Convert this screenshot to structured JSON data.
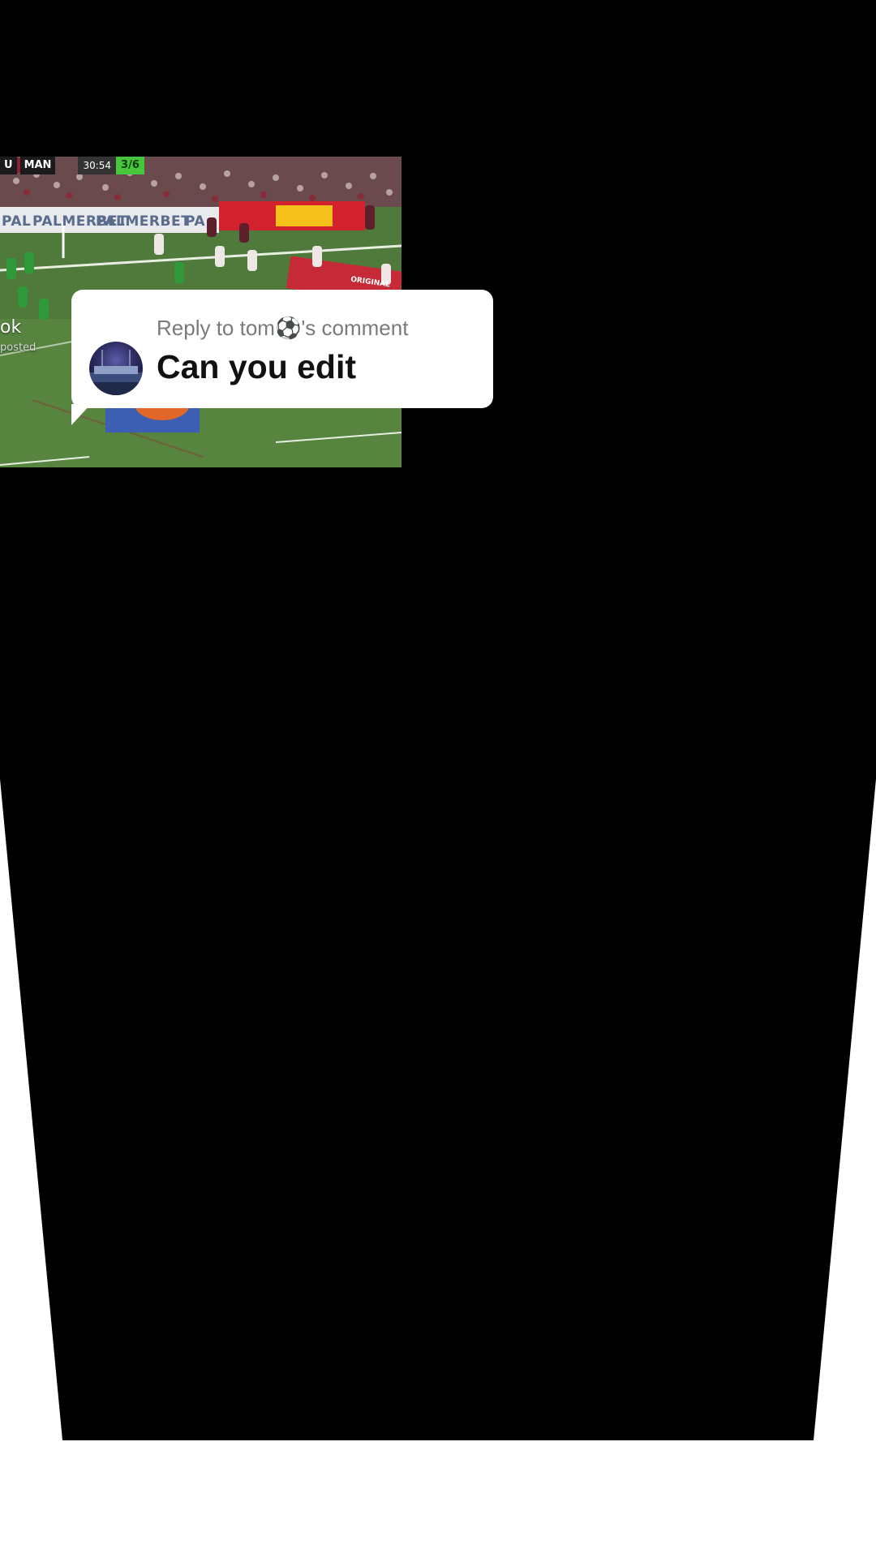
{
  "video": {
    "score_bug": {
      "team_left": "U",
      "team_right": "MAN",
      "clock": "30:54",
      "tag": "3/6"
    },
    "ads": {
      "sponsor_1": "PALMERBET",
      "sponsor_2": "PALMERBET",
      "sponsor_3": "PA",
      "sponsor_left": "PAL",
      "red_board": "ORIGINAL"
    },
    "overlay_left_1": "ok",
    "overlay_left_2": "posted"
  },
  "reply_card": {
    "label": "Reply to tom⚽'s comment",
    "comment": "Can you edit"
  },
  "colors": {
    "backdrop": "#000000",
    "bubble": "#ffffff",
    "label": "#7a7a7a",
    "comment": "#111111",
    "pitch": "#4f7a3c"
  }
}
